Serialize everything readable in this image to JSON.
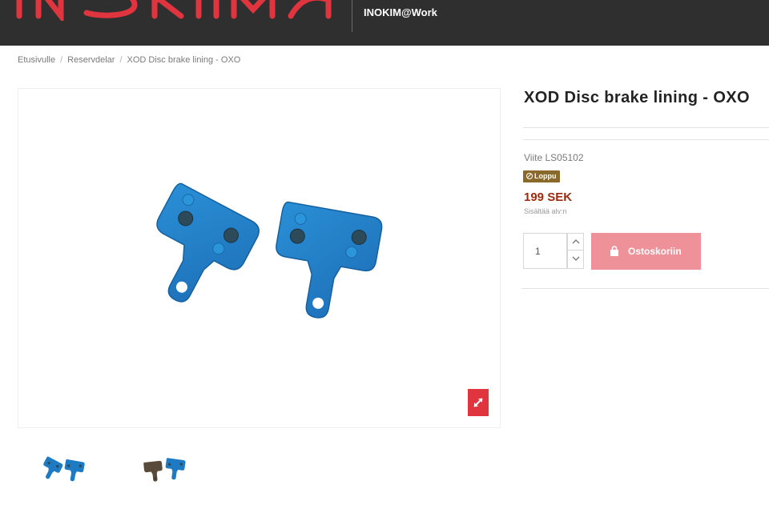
{
  "header": {
    "link_text": "INOKIM@Work",
    "logo_icon": "inokim-logo-icon",
    "brand_color": "#e0343f"
  },
  "breadcrumb": {
    "items": [
      "Etusivulle",
      "Reservdelar",
      "XOD Disc brake lining - OXO"
    ],
    "separator": "/"
  },
  "gallery": {
    "main_image_icon": "brake-pads-image",
    "expand_icon": "expand-icon",
    "thumbnails": [
      "brake-pads-blue-thumbnail",
      "brake-pads-brown-thumbnail"
    ]
  },
  "product": {
    "title": "XOD Disc brake lining - OXO",
    "reference": "Viite LS05102",
    "stock_label": "Loppu",
    "price": "199 SEK",
    "tax_note": "Sisältää alv:n",
    "quantity": "1",
    "add_to_cart_label": "Ostoskoriin",
    "price_color": "#9b2b0f",
    "cart_button_color": "#ef9198"
  }
}
